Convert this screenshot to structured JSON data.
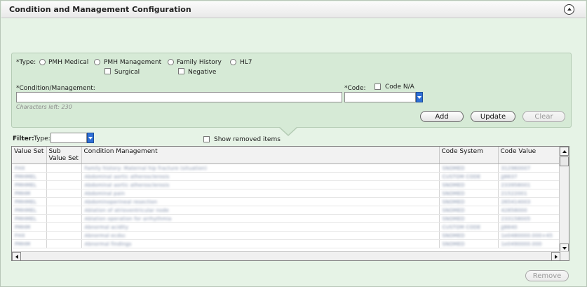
{
  "header": {
    "title": "Condition and Management Configuration"
  },
  "type_row": {
    "label": "*Type:",
    "options": [
      "PMH Medical",
      "PMH Management",
      "Family History",
      "HL7"
    ],
    "sub_options": [
      "Surgical",
      "Negative"
    ]
  },
  "condition": {
    "label": "*Condition/Management:",
    "value": "",
    "chars_left": "Characters left: 230"
  },
  "code": {
    "label": "*Code:",
    "na_label": "Code N/A",
    "value": ""
  },
  "buttons": {
    "add": "Add",
    "update": "Update",
    "clear": "Clear",
    "remove": "Remove"
  },
  "filter": {
    "label": "Filter:",
    "type_label": "Type:",
    "value": "",
    "show_removed": "Show removed items"
  },
  "grid": {
    "columns": [
      "Value Set",
      "Sub Value Set",
      "Condition Management",
      "Code System",
      "Code Value"
    ],
    "rows": [
      [
        "FHX",
        "",
        "Family history: Maternal hip fracture (situation)",
        "SNOMED",
        "312960007"
      ],
      [
        "PMHMEL",
        "",
        "Abdominal aortic atherosclerosis",
        "CUSTOM CODE",
        "JJ8837"
      ],
      [
        "PMHMEL",
        "",
        "Abdominal aortic atherosclerosis",
        "SNOMED",
        "233958001"
      ],
      [
        "PMHM",
        "",
        "Abdominal pain",
        "SNOMED",
        "21522001"
      ],
      [
        "PMHMEL",
        "",
        "Abdominoperineal resection",
        "SNOMED",
        "265414003"
      ],
      [
        "PMHMEL",
        "",
        "Ablation of atrioventricular node",
        "SNOMED",
        "42858000"
      ],
      [
        "PMHMEL",
        "",
        "Ablation operation for arrhythmia",
        "SNOMED",
        "233158005"
      ],
      [
        "PMHM",
        "",
        "Abnormal acidity",
        "CUSTOM CODE",
        "JJ8840"
      ],
      [
        "FHX",
        "",
        "Abnormal ecdsc",
        "SNOMED",
        "1e0480000.000+45"
      ],
      [
        "PMHM",
        "",
        "Abnormal findings",
        "SNOMED",
        "1e0490000.000"
      ]
    ]
  }
}
